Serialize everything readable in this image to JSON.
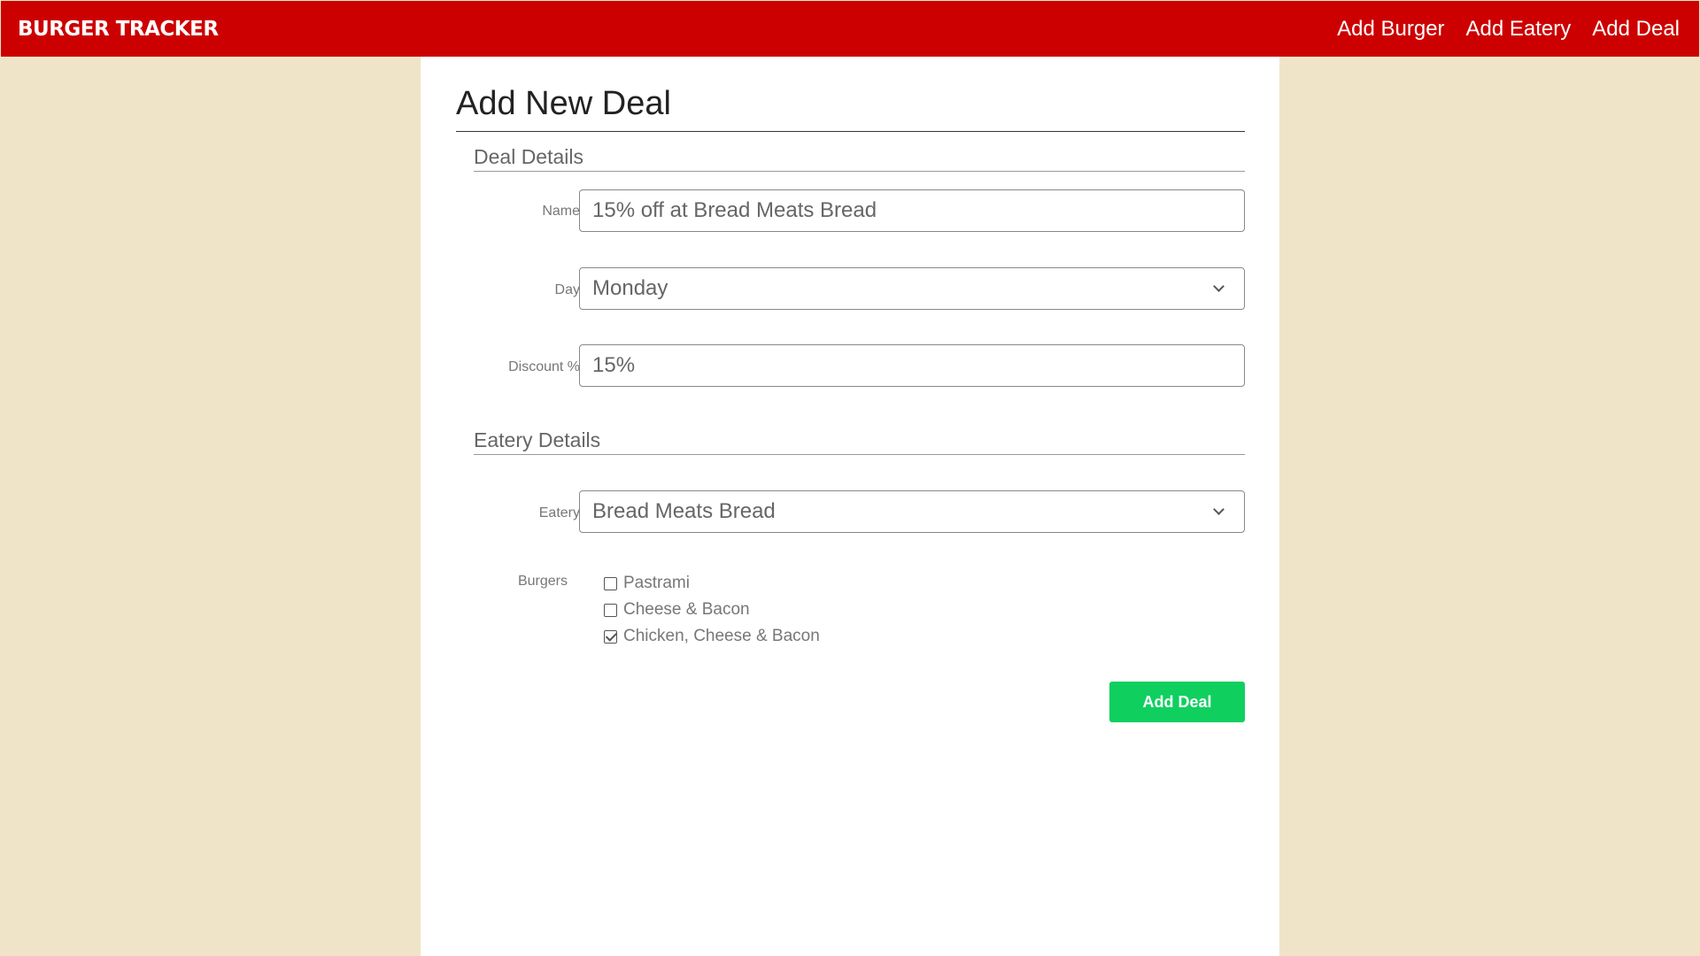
{
  "navbar": {
    "brand": "BURGER TRACKER",
    "links": [
      "Add Burger",
      "Add Eatery",
      "Add Deal"
    ],
    "color": "#cc0000"
  },
  "page": {
    "title": "Add New Deal",
    "background": "#efe4c8"
  },
  "deal_details": {
    "heading": "Deal Details",
    "name": {
      "label": "Name",
      "value": "15% off at Bread Meats Bread"
    },
    "day": {
      "label": "Day",
      "selected": "Monday",
      "icon": "chevron-down-icon"
    },
    "discount": {
      "label": "Discount %",
      "value": "15%"
    }
  },
  "eatery_details": {
    "heading": "Eatery Details",
    "eatery": {
      "label": "Eatery",
      "selected": "Bread Meats Bread",
      "icon": "chevron-down-icon"
    },
    "burgers": {
      "label": "Burgers",
      "options": [
        {
          "label": "Pastrami",
          "checked": false
        },
        {
          "label": "Cheese & Bacon",
          "checked": false
        },
        {
          "label": "Chicken, Cheese & Bacon",
          "checked": true
        }
      ]
    }
  },
  "submit": {
    "label": "Add Deal",
    "color": "#0fcf5f"
  }
}
